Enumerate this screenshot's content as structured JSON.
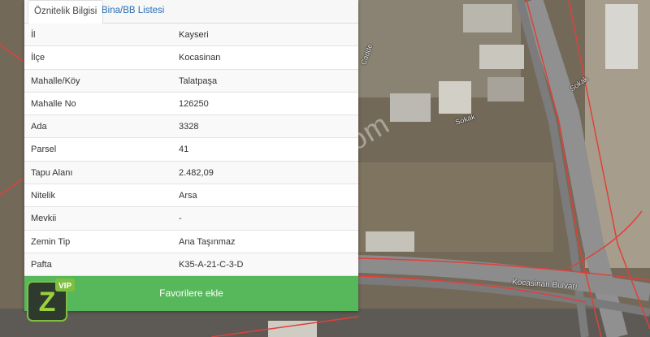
{
  "tabs": {
    "attributes": "Öznitelik Bilgisi",
    "buildings": "Bina/BB Listesi"
  },
  "attributes": [
    {
      "key": "İl",
      "value": "Kayseri"
    },
    {
      "key": "İlçe",
      "value": "Kocasinan"
    },
    {
      "key": "Mahalle/Köy",
      "value": "Talatpaşa"
    },
    {
      "key": "Mahalle No",
      "value": "126250"
    },
    {
      "key": "Ada",
      "value": "3328"
    },
    {
      "key": "Parsel",
      "value": "41"
    },
    {
      "key": "Tapu Alanı",
      "value": "2.482,09"
    },
    {
      "key": "Nitelik",
      "value": "Arsa"
    },
    {
      "key": "Mevkii",
      "value": "-"
    },
    {
      "key": "Zemin Tip",
      "value": "Ana Taşınmaz"
    },
    {
      "key": "Pafta",
      "value": "K35-A-21-C-3-D"
    }
  ],
  "favorite_button": "Favorilere ekle",
  "logo": {
    "letter": "Z",
    "badge": "VIP"
  },
  "map": {
    "watermark": "emlakjet.com",
    "labels": {
      "bulvar": "Kocasinan Bulvarı",
      "sokak1": "Sokak",
      "sokak2": "Sokak",
      "cadde": "Cadde"
    },
    "colors": {
      "parcel_line": "#e0403a",
      "road": "#8f8f8f",
      "terrain": "#7a6f5e"
    }
  },
  "colors": {
    "accent_green": "#57b75b",
    "tab_link": "#2a6fb0"
  }
}
